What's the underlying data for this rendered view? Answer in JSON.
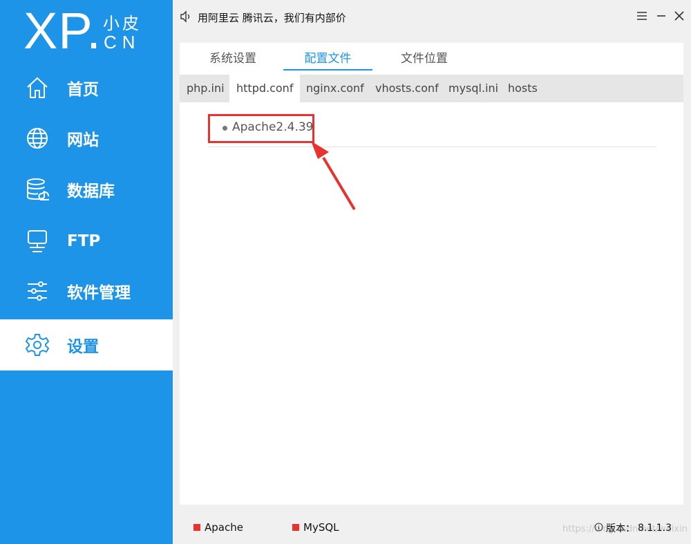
{
  "logo": {
    "main": "XP",
    "dot": ".",
    "top": "小皮",
    "bottom": "CN"
  },
  "nav": [
    {
      "key": "home",
      "label": "首页",
      "icon": "home-icon"
    },
    {
      "key": "website",
      "label": "网站",
      "icon": "globe-icon"
    },
    {
      "key": "database",
      "label": "数据库",
      "icon": "database-icon"
    },
    {
      "key": "ftp",
      "label": "FTP",
      "icon": "monitor-icon"
    },
    {
      "key": "software",
      "label": "软件管理",
      "icon": "sliders-icon"
    },
    {
      "key": "settings",
      "label": "设置",
      "icon": "gear-icon",
      "active": true
    }
  ],
  "titlebar": {
    "notice": "用阿里云 腾讯云，我们有内部价",
    "notice_icon": "speaker-icon"
  },
  "tabs": [
    {
      "label": "系统设置"
    },
    {
      "label": "配置文件",
      "active": true
    },
    {
      "label": "文件位置"
    }
  ],
  "file_tabs": [
    {
      "label": "php.ini"
    },
    {
      "label": "httpd.conf",
      "active": true
    },
    {
      "label": "nginx.conf"
    },
    {
      "label": "vhosts.conf"
    },
    {
      "label": "mysql.ini"
    },
    {
      "label": "hosts"
    }
  ],
  "versions": [
    {
      "label": "Apache2.4.39"
    }
  ],
  "status": {
    "services": [
      {
        "label": "Apache"
      },
      {
        "label": "MySQL"
      }
    ],
    "version_label": "版本：",
    "version": "8.1.1.3",
    "watermark": "https://blog.csdn.net/weixin"
  },
  "colors": {
    "accent": "#1e94e8",
    "highlight": "#e8322f",
    "service_dot": "#e8322f"
  }
}
